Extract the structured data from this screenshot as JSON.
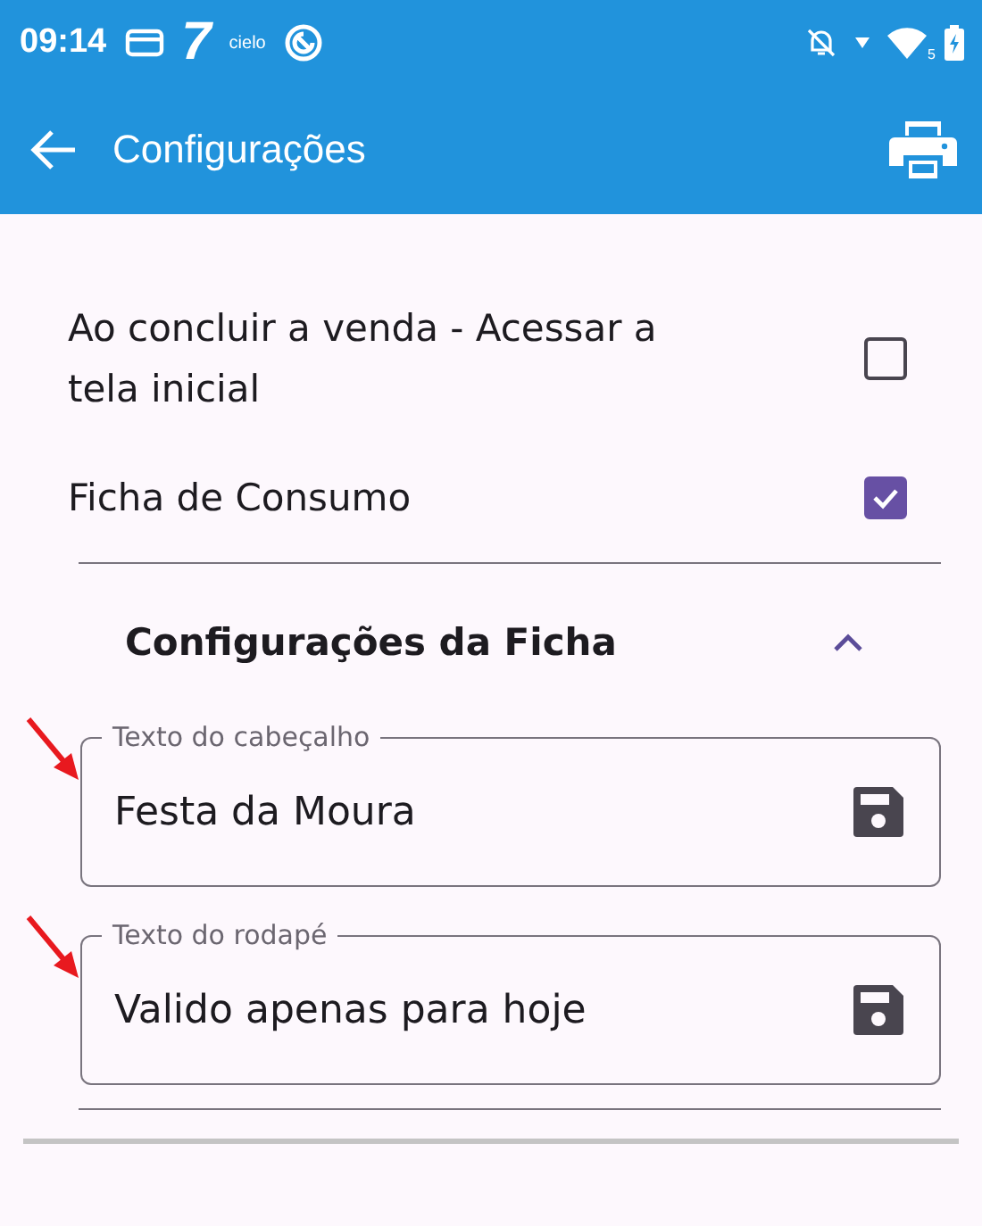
{
  "status_bar": {
    "time": "09:14",
    "logo_number": "7",
    "logo_text": "cielo",
    "wifi_label": "5"
  },
  "app_bar": {
    "title": "Configurações"
  },
  "settings": [
    {
      "kind": "checkbox",
      "label": "Ao concluir a venda - Acessar a tela inicial",
      "checked": false
    },
    {
      "kind": "checkbox",
      "label": "Ficha de Consumo",
      "checked": true
    }
  ],
  "section": {
    "title": "Configurações da Ficha",
    "expanded": true,
    "fields": [
      {
        "label": "Texto do cabeçalho",
        "value": "Festa da Moura"
      },
      {
        "label": "Texto do rodapé",
        "value": "Valido apenas para hoje"
      }
    ]
  }
}
